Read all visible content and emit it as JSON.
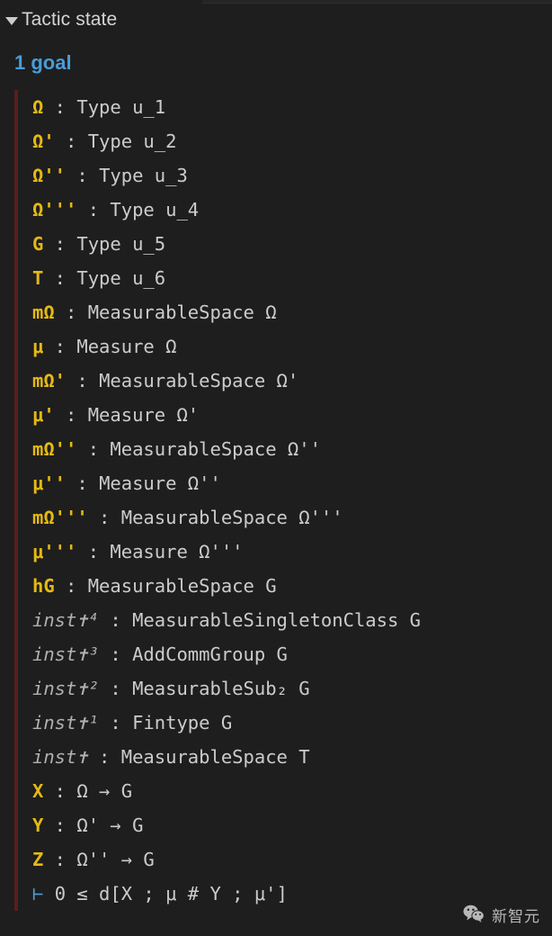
{
  "panel": {
    "header_label": "Tactic state",
    "disclosure_icon": "triangle-down-icon",
    "goal_count_label": "1 goal",
    "accent_blue": "#4a9cd6",
    "name_gold": "#e5b912",
    "goal_bar_maroon": "#5a1d1d",
    "background": "#1e1e1e",
    "text_gray": "#cccccc"
  },
  "goal": {
    "hypotheses": [
      {
        "name": "Ω",
        "sep": " : ",
        "type": "Type u_1",
        "italic": false
      },
      {
        "name": "Ω'",
        "sep": " : ",
        "type": "Type u_2",
        "italic": false
      },
      {
        "name": "Ω''",
        "sep": " : ",
        "type": "Type u_3",
        "italic": false
      },
      {
        "name": "Ω'''",
        "sep": " : ",
        "type": "Type u_4",
        "italic": false
      },
      {
        "name": "G",
        "sep": " : ",
        "type": "Type u_5",
        "italic": false
      },
      {
        "name": "T",
        "sep": " : ",
        "type": "Type u_6",
        "italic": false
      },
      {
        "name": "mΩ",
        "sep": " : ",
        "type": "MeasurableSpace Ω",
        "italic": false
      },
      {
        "name": "μ",
        "sep": " : ",
        "type": "Measure Ω",
        "italic": false
      },
      {
        "name": "mΩ'",
        "sep": " : ",
        "type": "MeasurableSpace Ω'",
        "italic": false
      },
      {
        "name": "μ'",
        "sep": " : ",
        "type": "Measure Ω'",
        "italic": false
      },
      {
        "name": "mΩ''",
        "sep": " : ",
        "type": "MeasurableSpace Ω''",
        "italic": false
      },
      {
        "name": "μ''",
        "sep": " : ",
        "type": "Measure Ω''",
        "italic": false
      },
      {
        "name": "mΩ'''",
        "sep": " : ",
        "type": "MeasurableSpace Ω'''",
        "italic": false
      },
      {
        "name": "μ'''",
        "sep": " : ",
        "type": "Measure Ω'''",
        "italic": false
      },
      {
        "name": "hG",
        "sep": " : ",
        "type": "MeasurableSpace G",
        "italic": false
      },
      {
        "name": "inst✝⁴",
        "sep": " : ",
        "type": "MeasurableSingletonClass G",
        "italic": true
      },
      {
        "name": "inst✝³",
        "sep": " : ",
        "type": "AddCommGroup G",
        "italic": true
      },
      {
        "name": "inst✝²",
        "sep": " : ",
        "type": "MeasurableSub₂ G",
        "italic": true
      },
      {
        "name": "inst✝¹",
        "sep": " : ",
        "type": "Fintype G",
        "italic": true
      },
      {
        "name": "inst✝",
        "sep": " : ",
        "type": "MeasurableSpace T",
        "italic": true
      },
      {
        "name": "X",
        "sep": " : ",
        "type": "Ω → G",
        "italic": false
      },
      {
        "name": "Y",
        "sep": " : ",
        "type": "Ω' → G",
        "italic": false
      },
      {
        "name": "Z",
        "sep": " : ",
        "type": "Ω'' → G",
        "italic": false
      }
    ],
    "turnstile": "⊢",
    "target": "0 ≤ d[X ; μ # Y ; μ']"
  },
  "watermark": {
    "icon": "wechat-icon",
    "label": "新智元"
  }
}
